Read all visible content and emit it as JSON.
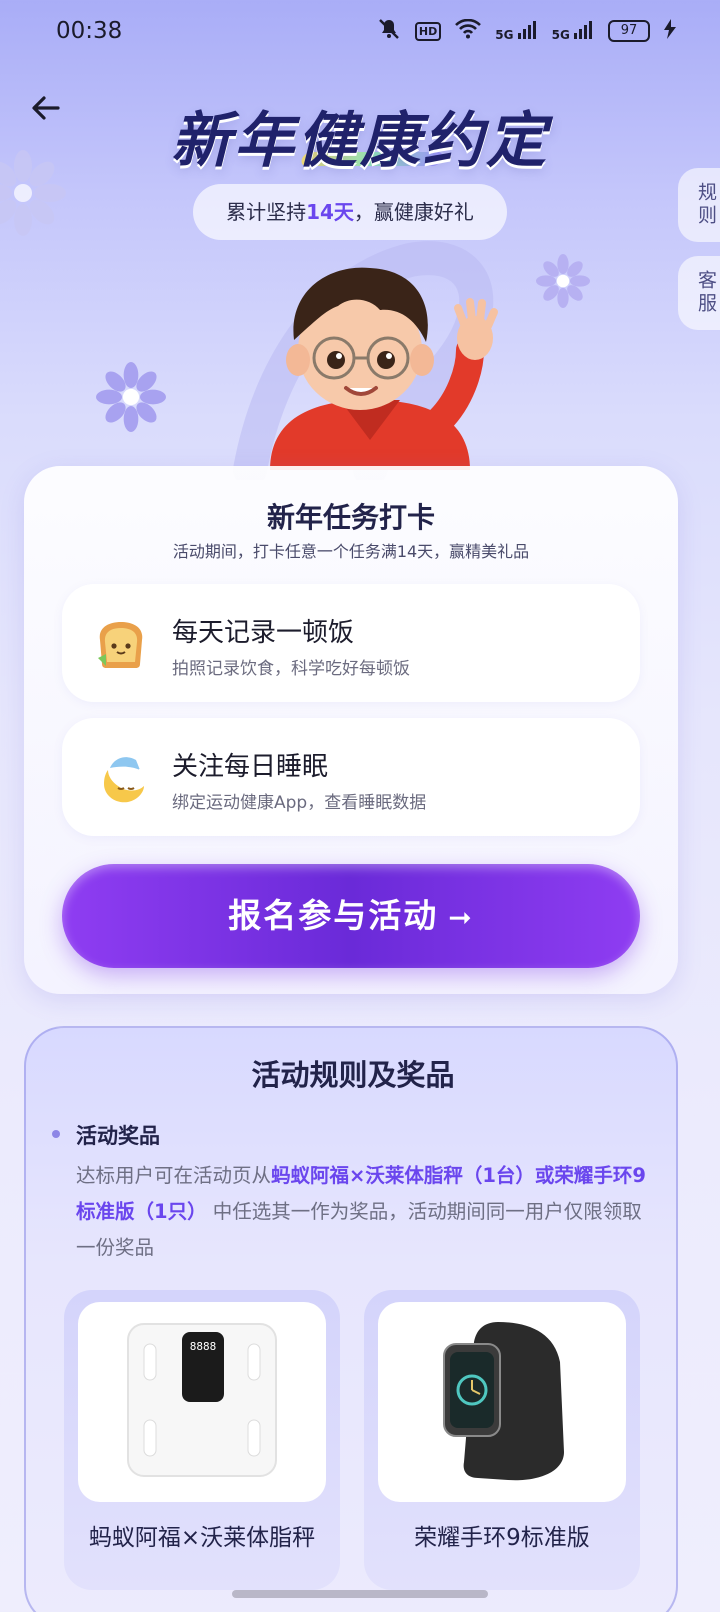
{
  "status_bar": {
    "time": "00:38",
    "hd": "HD",
    "sig1": "5G",
    "sig2": "5G",
    "battery": "97"
  },
  "header": {
    "title": "新年健康约定",
    "subtitle_prefix": "累计坚持",
    "subtitle_days": "14天",
    "subtitle_suffix": "，赢健康好礼",
    "side_tab_rules": "规则",
    "side_tab_service": "客服"
  },
  "task_card": {
    "title": "新年任务打卡",
    "subtitle": "活动期间，打卡任意一个任务满14天，赢精美礼品",
    "tasks": [
      {
        "name": "每天记录一顿饭",
        "desc": "拍照记录饮食，科学吃好每顿饭",
        "icon": "toast-icon"
      },
      {
        "name": "关注每日睡眠",
        "desc": "绑定运动健康App，查看睡眠数据",
        "icon": "moon-icon"
      }
    ],
    "join_button": "报名参与活动"
  },
  "rules_card": {
    "title": "活动规则及奖品",
    "section_head": "活动奖品",
    "body_prefix": "达标用户可在活动页从",
    "body_highlight": "蚂蚁阿福×沃莱体脂秤（1台）或荣耀手环9标准版（1只）",
    "body_suffix": " 中任选其一作为奖品，活动期间同一用户仅限领取一份奖品",
    "prizes": [
      {
        "name": "蚂蚁阿福×沃莱体脂秤",
        "scale_display": "8888"
      },
      {
        "name": "荣耀手环9标准版"
      }
    ]
  },
  "colors": {
    "accent": "#6a46ee",
    "button": "#7a33e3",
    "title": "#20226b"
  }
}
